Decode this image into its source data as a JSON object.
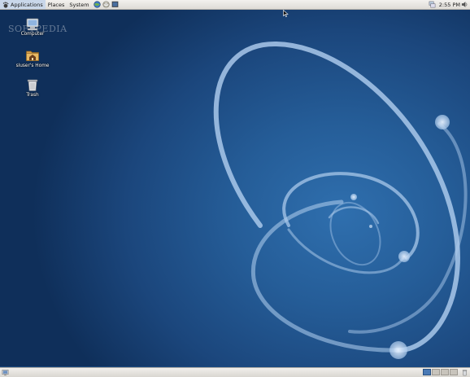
{
  "top_panel": {
    "menus": [
      {
        "label": "Applications",
        "icon": "gnome-foot-icon"
      },
      {
        "label": "Places"
      },
      {
        "label": "System"
      }
    ],
    "launchers": [
      "web-browser-icon",
      "mail-client-icon",
      "terminal-icon"
    ],
    "clock": "2:55 PM"
  },
  "desktop": {
    "watermark": "SOFTPEDIA",
    "icons": [
      {
        "label": "Computer",
        "icon": "computer-icon"
      },
      {
        "label": "sluser's Home",
        "icon": "home-folder-icon"
      },
      {
        "label": "Trash",
        "icon": "trash-icon"
      }
    ]
  },
  "bottom_panel": {
    "workspaces": 4,
    "active_workspace": 1
  },
  "colors": {
    "panel": "#dedbd6",
    "desktop_blue": "#255d98",
    "swirl": "#a9c8ea"
  }
}
